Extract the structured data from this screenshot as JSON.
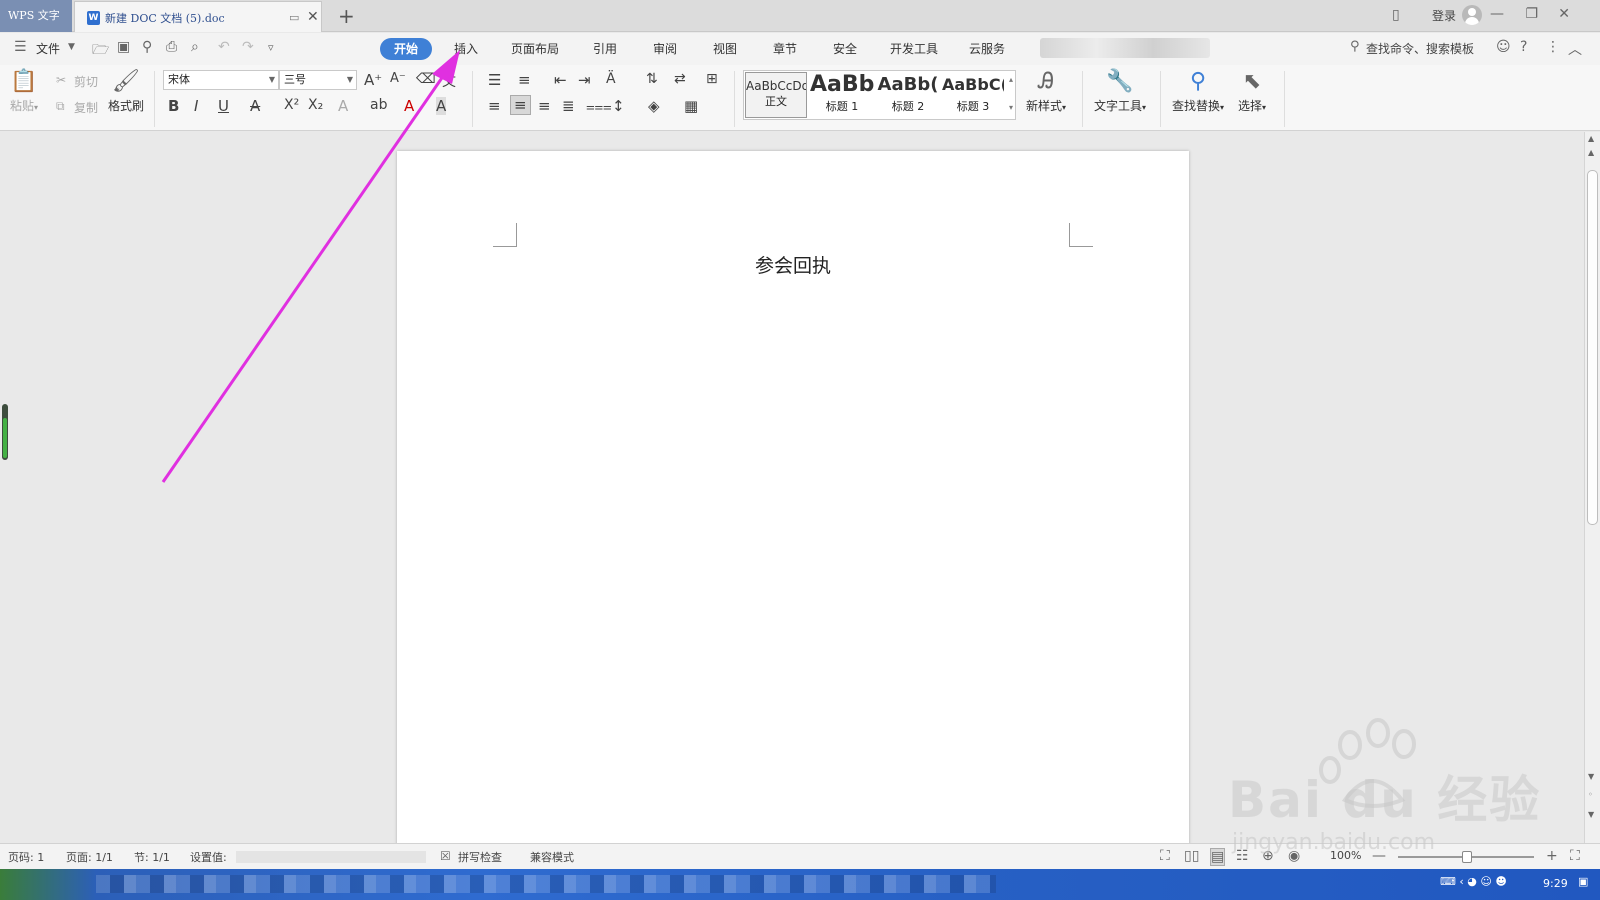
{
  "titlebar": {
    "app_tab": "WPS 文字",
    "doc_tab": "新建 DOC 文档 (5).doc",
    "new_tab_icon": "plus-icon",
    "login": "登录"
  },
  "menu": {
    "file": "文件",
    "tabs": [
      "开始",
      "插入",
      "页面布局",
      "引用",
      "审阅",
      "视图",
      "章节",
      "安全",
      "开发工具",
      "云服务"
    ],
    "active_tab": "开始",
    "search_command": "查找命令、搜索模板"
  },
  "ribbon": {
    "paste": "粘贴",
    "cut": "剪切",
    "copy": "复制",
    "format_painter": "格式刷",
    "font_name": "宋体",
    "font_size": "三号",
    "styles": [
      {
        "preview": "AaBbCcDd",
        "label": "正文"
      },
      {
        "preview": "AaBb",
        "label": "标题 1"
      },
      {
        "preview": "AaBb(",
        "label": "标题 2"
      },
      {
        "preview": "AaBbC(",
        "label": "标题 3"
      }
    ],
    "new_style": "新样式",
    "text_tools": "文字工具",
    "find_replace": "查找替换",
    "select": "选择"
  },
  "document": {
    "title": "参会回执"
  },
  "statusbar": {
    "page_no": "页码: 1",
    "pages": "页面: 1/1",
    "section": "节: 1/1",
    "setting": "设置值:",
    "spell_check": "拼写检查",
    "compat_mode": "兼容模式",
    "zoom": "100%"
  },
  "taskbar": {
    "clock": "9:29"
  },
  "watermark": {
    "main": "Bai du 经验",
    "sub": "jingyan.baidu.com"
  },
  "annotation": {
    "arrow_color": "#e030e0"
  },
  "colors": {
    "accent": "#3f80d6",
    "arrow": "#e030e0"
  }
}
